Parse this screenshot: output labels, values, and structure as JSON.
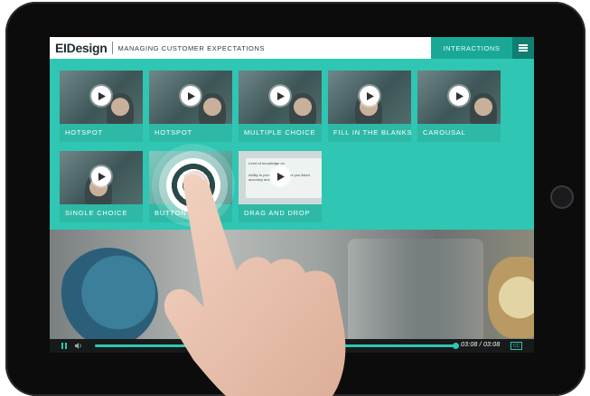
{
  "header": {
    "logo": "EIDesign",
    "course_title": "MANAGING CUSTOMER EXPECTATIONS",
    "interactions_tab": "INTERACTIONS",
    "menu_icon": "hamburger-menu-icon"
  },
  "tiles": [
    {
      "label": "HOTSPOT"
    },
    {
      "label": "HOTSPOT"
    },
    {
      "label": "MULTIPLE CHOICE"
    },
    {
      "label": "FILL IN THE BLANKS"
    },
    {
      "label": "CAROUSAL"
    },
    {
      "label": "SINGLE CHOICE"
    },
    {
      "label": "BUTTON"
    },
    {
      "label": "DRAG AND DROP"
    }
  ],
  "drag_drop_card": {
    "line1": "Level of knowledge on",
    "line2": "Ability to provide the service you listed",
    "line3": "accuracy and on time"
  },
  "player": {
    "time": "03:08 / 03:08",
    "progress_percent": 100,
    "cc_label": "CC",
    "play_icon": "pause-icon",
    "volume_icon": "speaker-icon"
  },
  "colors": {
    "accent": "#2fc6b3",
    "header_tab": "#1aa896",
    "menu_bg": "#0f7f72",
    "player_bg": "#171a1b"
  }
}
